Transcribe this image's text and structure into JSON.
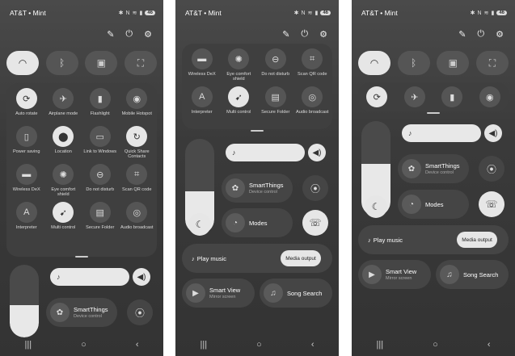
{
  "status": {
    "carrier": "AT&T • Mint",
    "battery": "46"
  },
  "icons": {
    "pencil": "✎",
    "power": "⏻",
    "gear": "⚙",
    "bluetooth": "ᛒ",
    "music": "♪",
    "volume": "🔈",
    "moon": "☾",
    "sun": "☀",
    "nav_recents": "|||",
    "nav_home": "○",
    "nav_back": "‹"
  },
  "quick": {
    "auto_rotate": "Auto rotate",
    "airplane": "Airplane mode",
    "flashlight": "Flashlight",
    "hotspot": "Mobile Hotspot",
    "power_saving": "Power saving",
    "location": "Location",
    "link_windows": "Link to Windows",
    "quick_share": "Quick Share Contacts",
    "wireless_dex": "Wireless DeX",
    "eye_comfort": "Eye comfort shield",
    "dnd": "Do not disturb",
    "scan_qr": "Scan QR code",
    "interpreter": "Interpreter",
    "multi_control": "Multi control",
    "secure_folder": "Secure Folder",
    "audio_broadcast": "Audio broadcast"
  },
  "cards": {
    "smartthings_title": "SmartThings",
    "smartthings_sub": "Device control",
    "modes": "Modes",
    "play_music": "Play music",
    "media_output": "Media output",
    "smart_view_title": "Smart View",
    "smart_view_sub": "Mirror screen",
    "song_search": "Song Search"
  },
  "brightness": {
    "panel1": 0.45,
    "panel2": 0.45,
    "panel3": 0.55
  }
}
